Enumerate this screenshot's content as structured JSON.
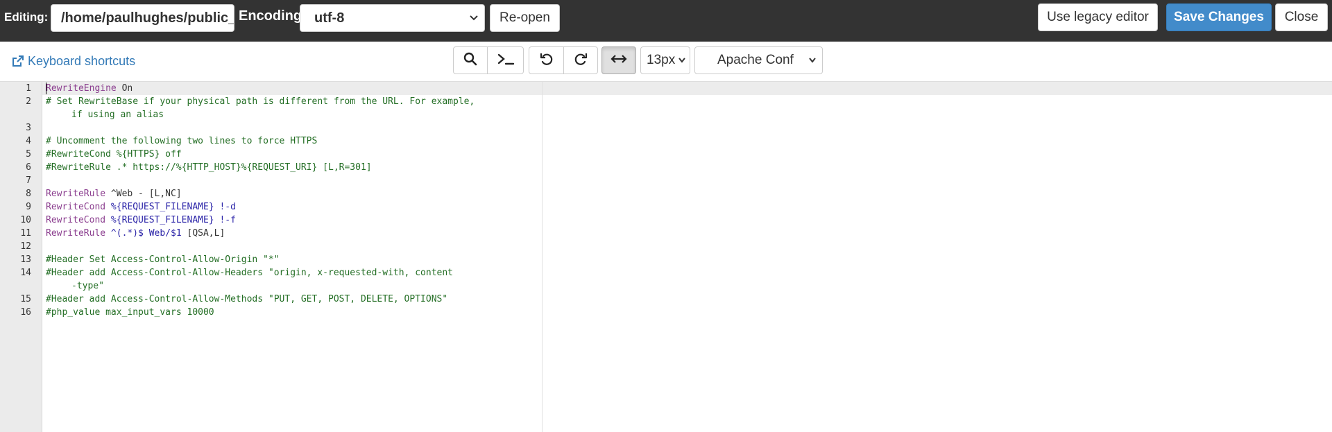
{
  "topbar": {
    "editing_label": "Editing:",
    "path_value": "/home/paulhughes/public_html/.htaccess",
    "encoding_label": "Encoding:",
    "encoding_value": "utf-8",
    "reopen_label": "Re-open",
    "legacy_label": "Use legacy editor",
    "save_label": "Save Changes",
    "close_label": "Close"
  },
  "toolbar": {
    "keyboard_shortcuts_label": "Keyboard shortcuts",
    "font_size_value": "13px",
    "mode_value": "Apache Conf",
    "icons": [
      "search-icon",
      "terminal-icon",
      "undo-icon",
      "redo-icon",
      "wrap-icon",
      "external-link-icon"
    ]
  },
  "colors": {
    "topbar_bg": "#333333",
    "primary": "#428bca",
    "link": "#337ab7",
    "keyword": "#8b3e8f",
    "comment": "#236e24",
    "variable": "#2b24a8"
  },
  "editor": {
    "lines": [
      {
        "n": "1",
        "segments": [
          {
            "t": "RewriteEngine",
            "c": "kw"
          },
          {
            "t": " On",
            "c": "plain"
          }
        ]
      },
      {
        "n": "2",
        "segments": [
          {
            "t": "# Set RewriteBase if your physical path is different from the URL. For example,",
            "c": "cm"
          }
        ],
        "wrap": [
          {
            "t": "if using an alias",
            "c": "cm"
          }
        ]
      },
      {
        "n": "3",
        "segments": []
      },
      {
        "n": "4",
        "segments": [
          {
            "t": "# Uncomment the following two lines to force HTTPS",
            "c": "cm"
          }
        ]
      },
      {
        "n": "5",
        "segments": [
          {
            "t": "#RewriteCond %{HTTPS} off",
            "c": "cm"
          }
        ]
      },
      {
        "n": "6",
        "segments": [
          {
            "t": "#RewriteRule .* https://%{HTTP_HOST}%{REQUEST_URI} [L,R=301]",
            "c": "cm"
          }
        ]
      },
      {
        "n": "7",
        "segments": []
      },
      {
        "n": "8",
        "segments": [
          {
            "t": "RewriteRule",
            "c": "kw"
          },
          {
            "t": " ^Web - [L,NC]",
            "c": "plain"
          }
        ]
      },
      {
        "n": "9",
        "segments": [
          {
            "t": "RewriteCond",
            "c": "kw"
          },
          {
            "t": " ",
            "c": "plain"
          },
          {
            "t": "%{REQUEST_FILENAME}",
            "c": "var"
          },
          {
            "t": " !-d",
            "c": "var"
          }
        ]
      },
      {
        "n": "10",
        "segments": [
          {
            "t": "RewriteCond",
            "c": "kw"
          },
          {
            "t": " ",
            "c": "plain"
          },
          {
            "t": "%{REQUEST_FILENAME}",
            "c": "var"
          },
          {
            "t": " !-f",
            "c": "var"
          }
        ]
      },
      {
        "n": "11",
        "segments": [
          {
            "t": "RewriteRule",
            "c": "kw"
          },
          {
            "t": " ",
            "c": "plain"
          },
          {
            "t": "^(.*)$ Web/$1",
            "c": "var"
          },
          {
            "t": " [QSA,L]",
            "c": "plain"
          }
        ]
      },
      {
        "n": "12",
        "segments": []
      },
      {
        "n": "13",
        "segments": [
          {
            "t": "#Header Set Access-Control-Allow-Origin \"*\"",
            "c": "cm"
          }
        ]
      },
      {
        "n": "14",
        "segments": [
          {
            "t": "#Header add Access-Control-Allow-Headers \"origin, x-requested-with, content",
            "c": "cm"
          }
        ],
        "wrap": [
          {
            "t": "-type\"",
            "c": "cm"
          }
        ]
      },
      {
        "n": "15",
        "segments": [
          {
            "t": "#Header add Access-Control-Allow-Methods \"PUT, GET, POST, DELETE, OPTIONS\"",
            "c": "cm"
          }
        ]
      },
      {
        "n": "16",
        "segments": [
          {
            "t": "#php_value max_input_vars 10000",
            "c": "cm"
          }
        ]
      }
    ]
  }
}
